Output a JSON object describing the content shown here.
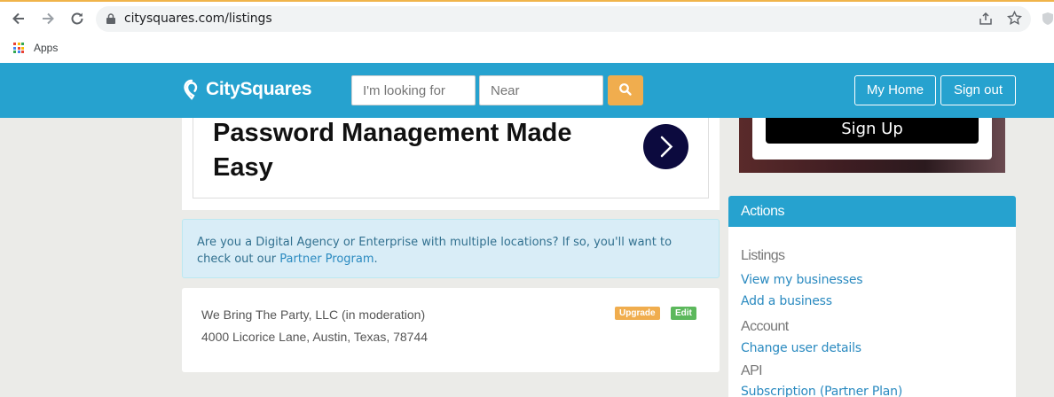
{
  "browser": {
    "url": "citysquares.com/listings",
    "bookmark_apps": "Apps",
    "apps_colors": [
      "#ea4335",
      "#fbbc05",
      "#34a853",
      "#4285f4",
      "#ea4335",
      "#fbbc05",
      "#34a853",
      "#4285f4",
      "#ea4335"
    ]
  },
  "header": {
    "logo_text": "CitySquares",
    "search_placeholder": "I'm looking for",
    "near_placeholder": "Near",
    "my_home": "My Home",
    "sign_out": "Sign out",
    "bg_color": "#26a2cf",
    "search_btn_color": "#f0ad4e"
  },
  "ad": {
    "title": "Password Management Made Easy"
  },
  "partner_notice": {
    "text_before": "Are you a Digital Agency or Enterprise with multiple locations? If so, you'll want to check out our ",
    "link": "Partner Program",
    "text_after": "."
  },
  "listing": {
    "name": "We Bring The Party, LLC (in moderation)",
    "address": "4000 Licorice Lane, Austin, Texas, 78744",
    "upgrade_label": "Upgrade",
    "edit_label": "Edit",
    "upgrade_color": "#f0ad4e",
    "edit_color": "#5cb85c"
  },
  "promo": {
    "signup_label": "Sign Up"
  },
  "actions": {
    "title": "Actions",
    "listings_label": "Listings",
    "view_businesses": "View my businesses",
    "add_business": "Add a business",
    "account_label": "Account",
    "change_user": "Change user details",
    "api_label": "API",
    "subscription": "Subscription (Partner Plan)"
  }
}
